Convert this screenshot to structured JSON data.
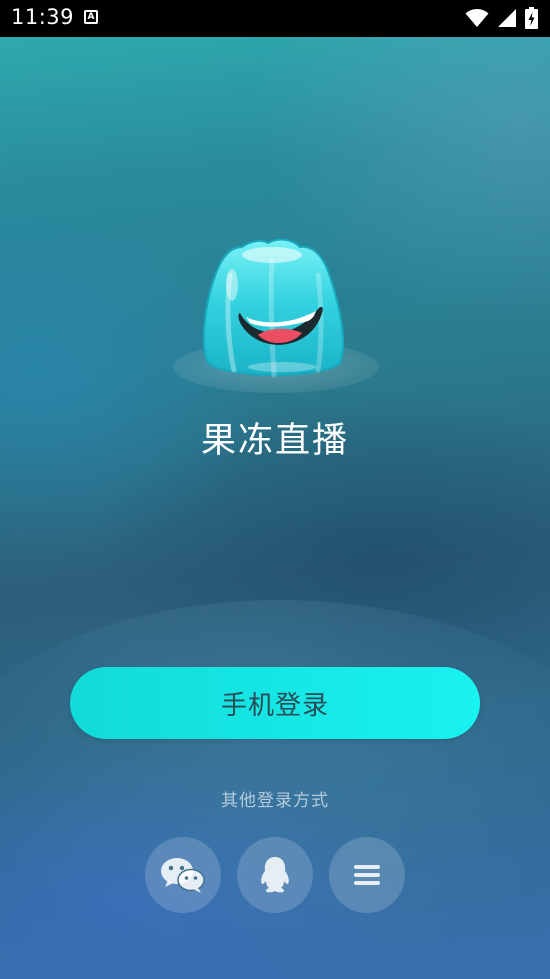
{
  "status_bar": {
    "time": "11:39",
    "notification_icon": "text-a-icon",
    "icons": [
      "wifi-icon",
      "signal-icon",
      "battery-charging-icon"
    ]
  },
  "app": {
    "logo_icon": "jelly-mascot-icon",
    "name": "果冻直播"
  },
  "login": {
    "phone_login_label": "手机登录",
    "other_methods_label": "其他登录方式",
    "social_buttons": [
      {
        "icon": "wechat-icon"
      },
      {
        "icon": "qq-icon"
      },
      {
        "icon": "menu-icon"
      }
    ]
  },
  "colors": {
    "button_primary": "#18f2f0",
    "button_text": "#2a4b57",
    "status_bar": "#000000"
  }
}
